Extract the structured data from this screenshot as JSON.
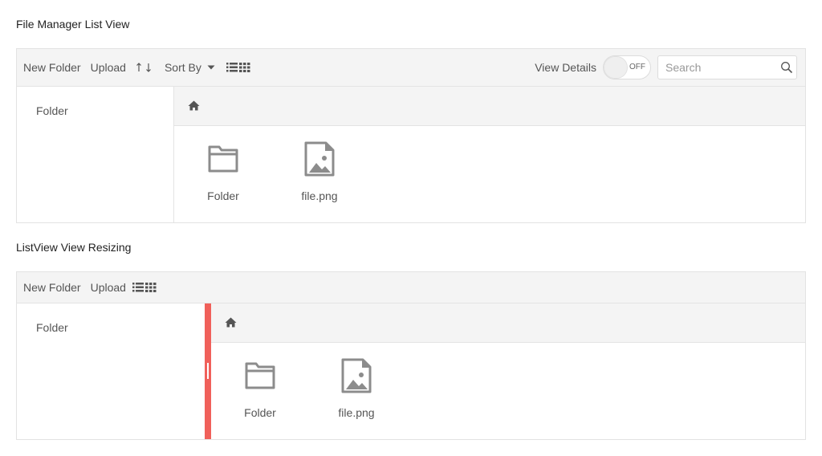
{
  "sections": [
    {
      "title": "File Manager List View",
      "toolbar": {
        "new_folder": "New Folder",
        "upload": "Upload",
        "sort_by": "Sort By",
        "view_details_label": "View Details",
        "toggle_state": "OFF",
        "search_placeholder": "Search"
      },
      "nav": {
        "item": "Folder"
      },
      "files": [
        {
          "name": "Folder",
          "icon": "folder-icon"
        },
        {
          "name": "file.png",
          "icon": "image-file-icon"
        }
      ]
    },
    {
      "title": "ListView View Resizing",
      "toolbar": {
        "new_folder": "New Folder",
        "upload": "Upload"
      },
      "nav": {
        "item": "Folder"
      },
      "files": [
        {
          "name": "Folder",
          "icon": "folder-icon"
        },
        {
          "name": "file.png",
          "icon": "image-file-icon"
        }
      ]
    }
  ],
  "colors": {
    "resizer": "#f0605a",
    "toolbar_bg": "#f4f4f4",
    "icon": "#8c8c8c"
  },
  "icons": [
    "sort-ascending-icon",
    "sort-descending-icon",
    "dropdown-caret-icon",
    "view-toggle-icon",
    "search-icon",
    "home-icon",
    "folder-icon",
    "image-file-icon"
  ]
}
